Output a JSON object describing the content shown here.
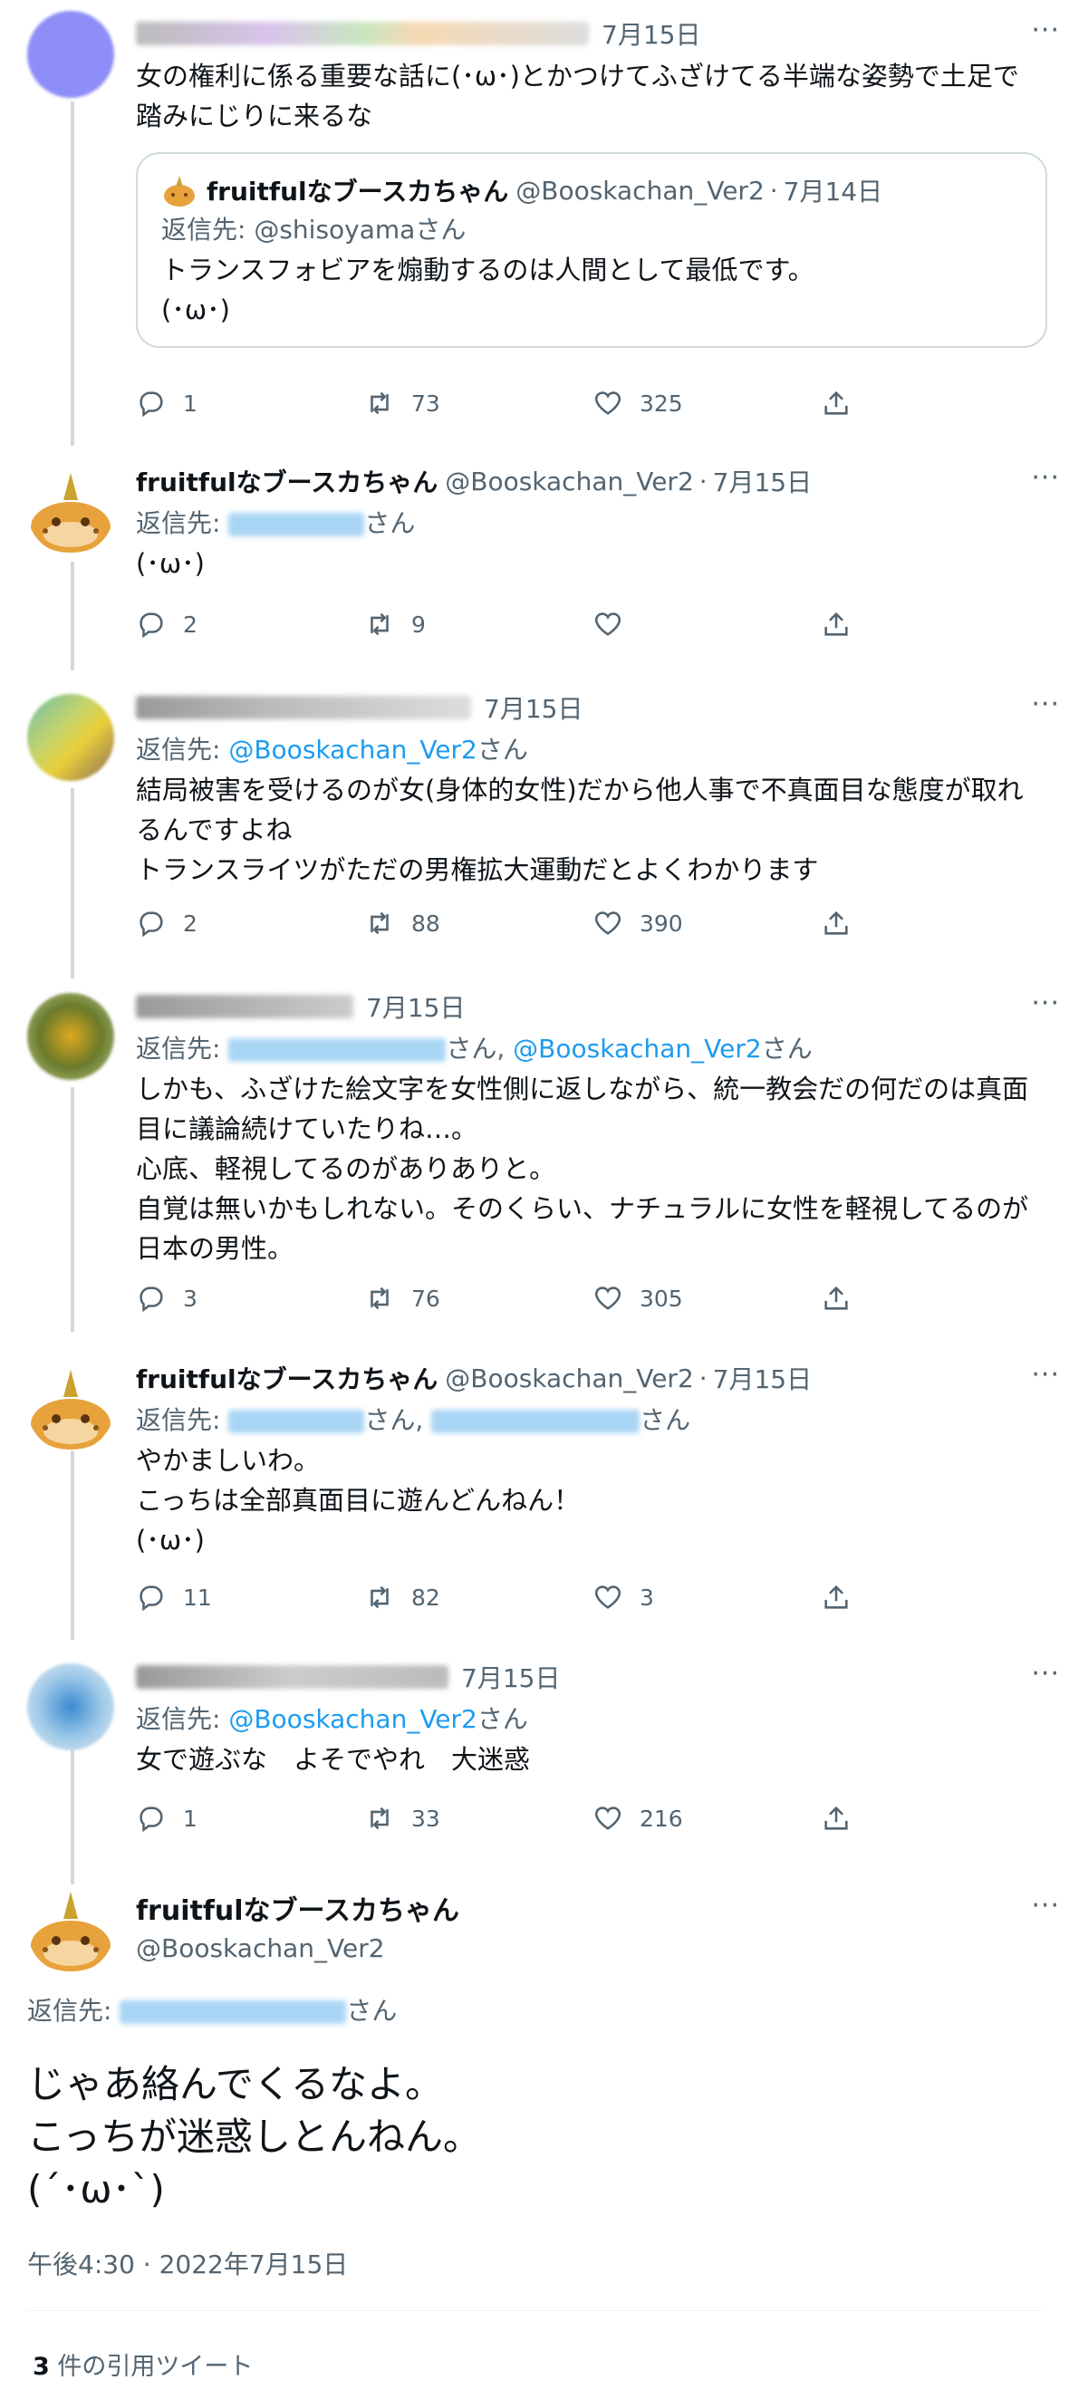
{
  "tweets": [
    {
      "time": "7月15日",
      "text": "女の権利に係る重要な話に(･ω･)とかつけてふざけてる半端な姿勢で土足で踏みにじりに来るな",
      "quote": {
        "name": "fruitfulなブースカちゃん",
        "handle": "@Booskachan_Ver2",
        "time": "7月14日",
        "reply_prefix": "返信先: ",
        "reply_to": "@shisoyamaさん",
        "text": "トランスフォビアを煽動するのは人間として最低です。\n(･ω･)"
      },
      "replies": "1",
      "retweets": "73",
      "likes": "325"
    },
    {
      "name": "fruitfulなブースカちゃん",
      "handle": "@Booskachan_Ver2",
      "time": "7月15日",
      "reply_prefix": "返信先: ",
      "reply_suffix": "さん",
      "text": "(･ω･)",
      "replies": "2",
      "retweets": "9",
      "likes": ""
    },
    {
      "time": "7月15日",
      "reply_prefix": "返信先: ",
      "reply_link": "@Booskachan_Ver2",
      "reply_suffix": "さん",
      "text": "結局被害を受けるのが女(身体的女性)だから他人事で不真面目な態度が取れるんですよね\nトランスライツがただの男権拡大運動だとよくわかります",
      "replies": "2",
      "retweets": "88",
      "likes": "390"
    },
    {
      "time": "7月15日",
      "reply_prefix": "返信先: ",
      "reply_mid": "さん, ",
      "reply_link": "@Booskachan_Ver2",
      "reply_suffix": "さん",
      "text": "しかも、ふざけた絵文字を女性側に返しながら、統一教会だの何だのは真面目に議論続けていたりね…。\n心底、軽視してるのがありありと。\n自覚は無いかもしれない。そのくらい、ナチュラルに女性を軽視してるのが日本の男性。",
      "replies": "3",
      "retweets": "76",
      "likes": "305"
    },
    {
      "name": "fruitfulなブースカちゃん",
      "handle": "@Booskachan_Ver2",
      "time": "7月15日",
      "reply_prefix": "返信先: ",
      "reply_mid": "さん, ",
      "reply_suffix": "さん",
      "text": "やかましいわ。\nこっちは全部真面目に遊んどんねん！\n(･ω･)",
      "replies": "11",
      "retweets": "82",
      "likes": "3"
    },
    {
      "time": "7月15日",
      "reply_prefix": "返信先: ",
      "reply_link": "@Booskachan_Ver2",
      "reply_suffix": "さん",
      "text": "女で遊ぶな　よそでやれ　大迷惑",
      "replies": "1",
      "retweets": "33",
      "likes": "216"
    }
  ],
  "main": {
    "name": "fruitfulなブースカちゃん",
    "handle": "@Booskachan_Ver2",
    "reply_prefix": "返信先: ",
    "reply_suffix": "さん",
    "text": "じゃあ絡んでくるなよ。\nこっちが迷惑しとんねん。\n(´･ω･`)",
    "timestamp": "午後4:30 · 2022年7月15日",
    "quote_count": "3",
    "quote_label": " 件の引用ツイート"
  },
  "colors": {
    "link": "#1d9bf0",
    "secondary": "#536471",
    "line": "#cfd9de"
  }
}
